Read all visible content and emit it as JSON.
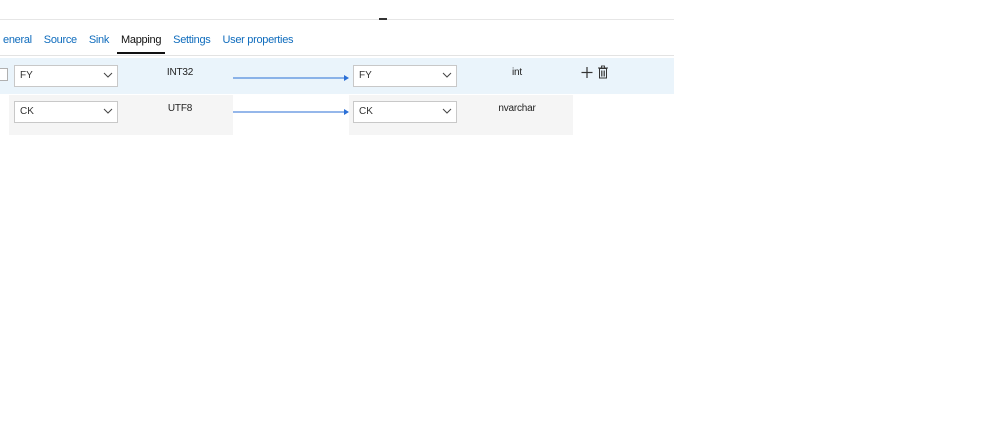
{
  "tabs": [
    {
      "label": "eneral"
    },
    {
      "label": "Source"
    },
    {
      "label": "Sink"
    },
    {
      "label": "Mapping"
    },
    {
      "label": "Settings"
    },
    {
      "label": "User properties"
    }
  ],
  "active_tab": "Mapping",
  "mappings": [
    {
      "source_column": "FY",
      "source_type": "INT32",
      "sink_column": "FY",
      "sink_type": "int"
    },
    {
      "source_column": "CK",
      "source_type": "UTF8",
      "sink_column": "CK",
      "sink_type": "nvarchar"
    }
  ],
  "colors": {
    "accent": "#0f6cbd",
    "selected_row": "#eaf4fb",
    "arrow": "#2b6fd6"
  },
  "icons": {
    "dropdown": "chevron-down-icon",
    "add": "plus-icon",
    "delete": "trash-icon",
    "mapping": "arrow-right-icon"
  }
}
